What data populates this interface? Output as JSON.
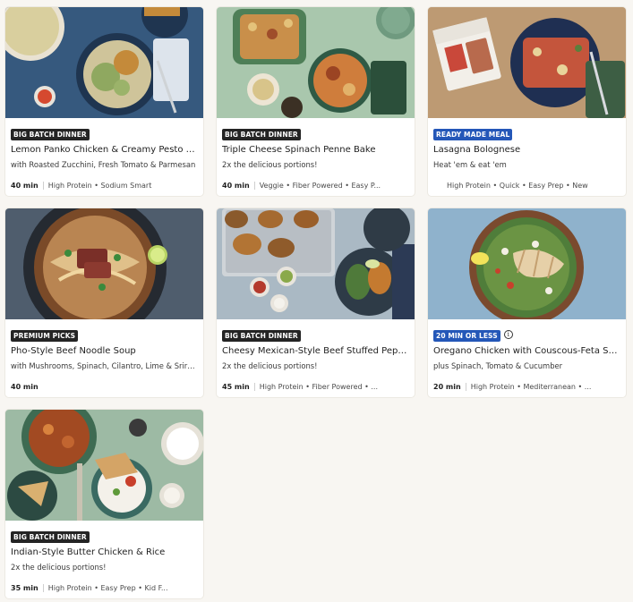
{
  "colors": {
    "page_bg": "#f8f6f2",
    "badge_dark": "#242424",
    "badge_blue": "#2457b8"
  },
  "cards": [
    {
      "badge": "BIG BATCH DINNER",
      "badge_style": "dark",
      "title": "Lemon Panko Chicken & Creamy Pesto Pasta",
      "subtitle": "with Roasted Zucchini, Fresh Tomato & Parmesan",
      "time": "40 min",
      "tags": "High Protein • Sodium Smart",
      "image": "pesto-pasta-photo"
    },
    {
      "badge": "BIG BATCH DINNER",
      "badge_style": "dark",
      "title": "Triple Cheese Spinach Penne Bake",
      "subtitle": "2x the delicious portions!",
      "time": "40 min",
      "tags": "Veggie • Fiber Powered • Easy P...",
      "image": "penne-bake-photo"
    },
    {
      "badge": "READY MADE MEAL",
      "badge_style": "blue",
      "title": "Lasagna Bolognese",
      "subtitle": "Heat 'em & eat 'em",
      "time": "",
      "tags": "High Protein • Quick • Easy Prep • New",
      "image": "lasagna-photo"
    },
    {
      "badge": "PREMIUM PICKS",
      "badge_style": "dark",
      "title": "Pho-Style Beef Noodle Soup",
      "subtitle": "with Mushrooms, Spinach, Cilantro, Lime & Sriracha",
      "time": "40 min",
      "tags": "",
      "image": "pho-photo"
    },
    {
      "badge": "BIG BATCH DINNER",
      "badge_style": "dark",
      "title": "Cheesy Mexican-Style Beef Stuffed Peppers",
      "subtitle": "2x the delicious portions!",
      "time": "45 min",
      "tags": "High Protein • Fiber Powered • ...",
      "image": "stuffed-peppers-photo"
    },
    {
      "badge": "20 MIN OR LESS",
      "badge_style": "blue",
      "info_icon": true,
      "title": "Oregano Chicken with Couscous-Feta Salad",
      "subtitle": "plus Spinach, Tomato & Cucumber",
      "time": "20 min",
      "tags": "High Protein • Mediterranean • ...",
      "image": "oregano-chicken-photo"
    },
    {
      "badge": "BIG BATCH DINNER",
      "badge_style": "dark",
      "title": "Indian-Style Butter Chicken & Rice",
      "subtitle": "2x the delicious portions!",
      "time": "35 min",
      "tags": "High Protein • Easy Prep • Kid F...",
      "image": "butter-chicken-photo"
    }
  ]
}
